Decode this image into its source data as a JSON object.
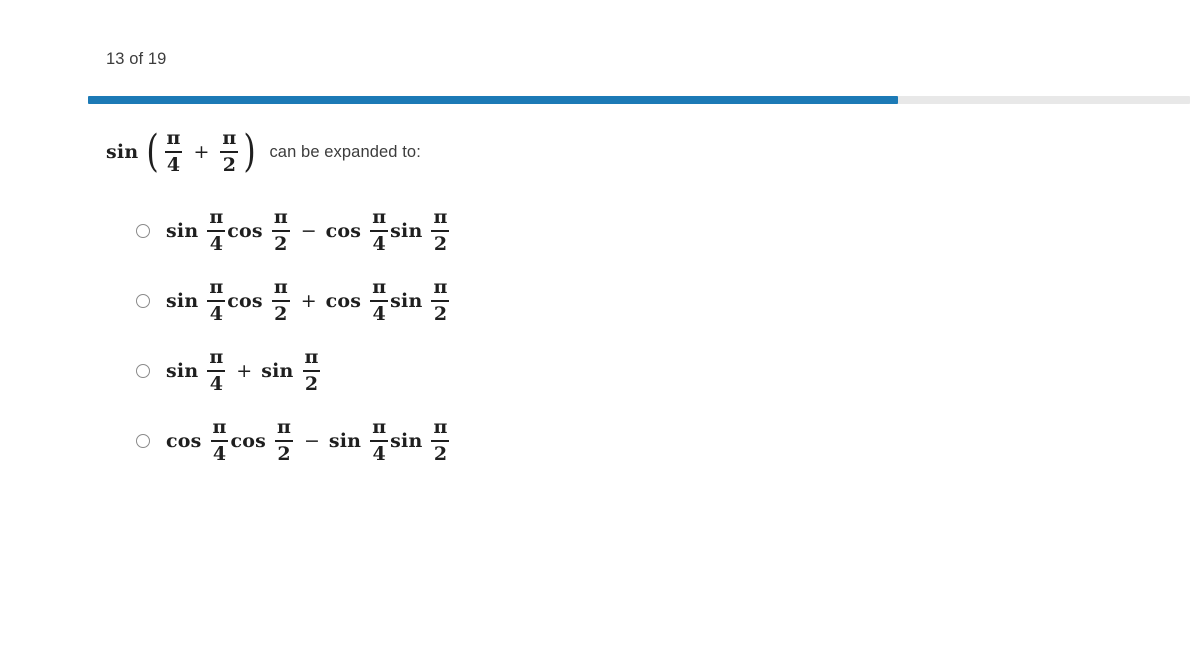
{
  "header": {
    "page_counter": "13 of 19"
  },
  "progress": {
    "value_percent": 73.5,
    "fill_color": "#1c7ab6",
    "track_color": "#e8e8e8"
  },
  "question": {
    "prompt_function": "sin",
    "prompt_fraction_1": {
      "numerator": "π",
      "denominator": "4"
    },
    "prompt_operator": "+",
    "prompt_fraction_2": {
      "numerator": "π",
      "denominator": "2"
    },
    "paren_open": "(",
    "paren_close": ")",
    "text": "can be expanded to:"
  },
  "options": [
    {
      "id": "option-a",
      "selected": false,
      "terms": [
        {
          "fn": "sin",
          "num": "π",
          "den": "4"
        },
        {
          "fn": "cos",
          "num": "π",
          "den": "2"
        }
      ],
      "operator": "−",
      "terms2": [
        {
          "fn": "cos",
          "num": "π",
          "den": "4"
        },
        {
          "fn": "sin",
          "num": "π",
          "den": "2"
        }
      ]
    },
    {
      "id": "option-b",
      "selected": false,
      "terms": [
        {
          "fn": "sin",
          "num": "π",
          "den": "4"
        },
        {
          "fn": "cos",
          "num": "π",
          "den": "2"
        }
      ],
      "operator": "+",
      "terms2": [
        {
          "fn": "cos",
          "num": "π",
          "den": "4"
        },
        {
          "fn": "sin",
          "num": "π",
          "den": "2"
        }
      ]
    },
    {
      "id": "option-c",
      "selected": false,
      "terms": [
        {
          "fn": "sin",
          "num": "π",
          "den": "4"
        }
      ],
      "operator": "+",
      "terms2": [
        {
          "fn": "sin",
          "num": "π",
          "den": "2"
        }
      ]
    },
    {
      "id": "option-d",
      "selected": false,
      "terms": [
        {
          "fn": "cos",
          "num": "π",
          "den": "4"
        },
        {
          "fn": "cos",
          "num": "π",
          "den": "2"
        }
      ],
      "operator": "−",
      "terms2": [
        {
          "fn": "sin",
          "num": "π",
          "den": "4"
        },
        {
          "fn": "sin",
          "num": "π",
          "den": "2"
        }
      ]
    }
  ]
}
